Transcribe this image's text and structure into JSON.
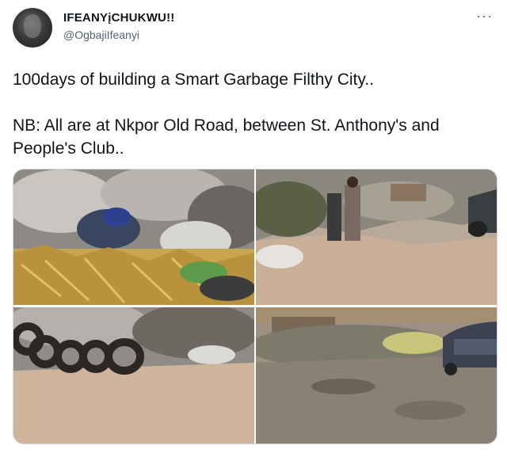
{
  "tweet": {
    "display_name": "IFEANYįCHUKWU!!",
    "handle": "@OgbajiIfeanyi",
    "more_label": "···",
    "lines": [
      "100days of building a Smart Garbage Filthy City..",
      "NB: All are at Nkpor Old Road, between St. Anthony's and People's Club.."
    ]
  },
  "icons": {
    "more": "more-dots-icon"
  }
}
